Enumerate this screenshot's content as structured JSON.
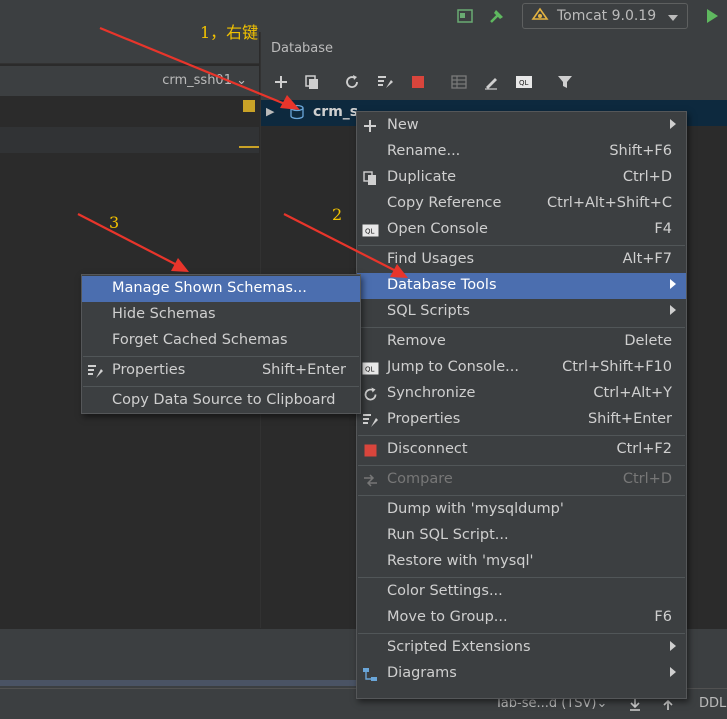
{
  "toolbar": {
    "run_config": "Tomcat 9.0.19",
    "icons": [
      "panel-icon",
      "hammer-icon",
      "tomcat-icon",
      "chevron-down-icon",
      "run-icon"
    ]
  },
  "left_panel": {
    "tab_label": "crm_ssh01 ⌄"
  },
  "db_panel": {
    "title": "Database",
    "toolbar_icons": [
      "add-icon",
      "copy-icon",
      "refresh-icon",
      "properties-icon",
      "stop-icon",
      "table-icon",
      "edit-icon",
      "console-icon",
      "filter-icon"
    ],
    "tree_row_label": "crm_s"
  },
  "context_menu": {
    "items": [
      {
        "label": "New",
        "shortcut": "",
        "submenu": true,
        "icon": "plus-icon"
      },
      {
        "label": "Rename...",
        "shortcut": "Shift+F6"
      },
      {
        "label": "Duplicate",
        "shortcut": "Ctrl+D",
        "icon": "duplicate-icon"
      },
      {
        "label": "Copy Reference",
        "shortcut": "Ctrl+Alt+Shift+C"
      },
      {
        "label": "Open Console",
        "shortcut": "F4",
        "icon": "console-icon"
      },
      {
        "label": "Find Usages",
        "shortcut": "Alt+F7"
      },
      {
        "label": "Database Tools",
        "shortcut": "",
        "submenu": true,
        "selected": true
      },
      {
        "label": "SQL Scripts",
        "shortcut": "",
        "submenu": true
      },
      {
        "label": "Remove",
        "shortcut": "Delete"
      },
      {
        "label": "Jump to Console...",
        "shortcut": "Ctrl+Shift+F10",
        "icon": "console-icon"
      },
      {
        "label": "Synchronize",
        "shortcut": "Ctrl+Alt+Y",
        "icon": "sync-icon"
      },
      {
        "label": "Properties",
        "shortcut": "Shift+Enter",
        "icon": "properties-icon"
      },
      {
        "label": "Disconnect",
        "shortcut": "Ctrl+F2",
        "icon": "stop-icon"
      },
      {
        "label": "Compare",
        "shortcut": "Ctrl+D",
        "disabled": true,
        "icon": "compare-icon"
      },
      {
        "label": "Dump with 'mysqldump'",
        "shortcut": ""
      },
      {
        "label": "Run SQL Script...",
        "shortcut": ""
      },
      {
        "label": "Restore with 'mysql'",
        "shortcut": ""
      },
      {
        "label": "Color Settings...",
        "shortcut": ""
      },
      {
        "label": "Move to Group...",
        "shortcut": "F6"
      },
      {
        "label": "Scripted Extensions",
        "shortcut": "",
        "submenu": true
      },
      {
        "label": "Diagrams",
        "shortcut": "",
        "submenu": true,
        "icon": "diagram-icon"
      }
    ]
  },
  "submenu": {
    "items": [
      {
        "label": "Manage Shown Schemas...",
        "shortcut": "",
        "selected": true
      },
      {
        "label": "Hide Schemas",
        "shortcut": ""
      },
      {
        "label": "Forget Cached Schemas",
        "shortcut": ""
      },
      {
        "label": "Properties",
        "shortcut": "Shift+Enter",
        "icon": "properties-icon"
      },
      {
        "label": "Copy Data Source to Clipboard",
        "shortcut": ""
      }
    ]
  },
  "annotations": {
    "step1": "1，右键",
    "step2": "2",
    "step3": "3",
    "color": "#f2c200",
    "arrow_color": "#e8352b"
  },
  "status_bar": {
    "format": "Tab-se...d (TSV)",
    "format_chevron": "⌄",
    "ddl": "DDL"
  },
  "colors": {
    "selection": "#4b6eaf",
    "menu_bg": "#3c3f41",
    "editor_bg": "#2b2b2b"
  }
}
